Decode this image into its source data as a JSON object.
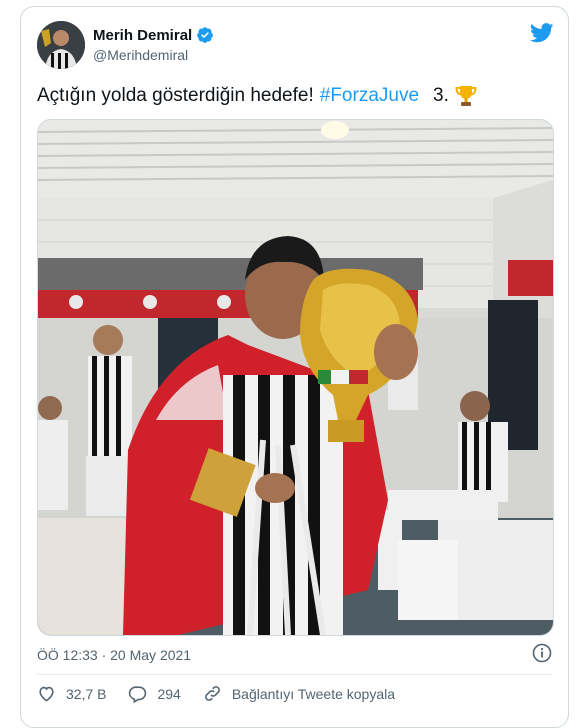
{
  "author": {
    "display_name": "Merih Demiral",
    "handle": "@Merihdemiral"
  },
  "tweet": {
    "text_main": "Açtığın yolda gösterdiğin hedefe!",
    "hashtag": "#ForzaJuve",
    "text_after": "3."
  },
  "meta": {
    "timestamp": "ÖÖ 12:33 · 20 May 2021"
  },
  "actions": {
    "like_count": "32,7 B",
    "reply_count": "294",
    "copy_link_label": "Bağlantıyı Tweete kopyala"
  },
  "colors": {
    "brand": "#1d9bf0",
    "text": "#0f1419",
    "muted": "#536471"
  }
}
